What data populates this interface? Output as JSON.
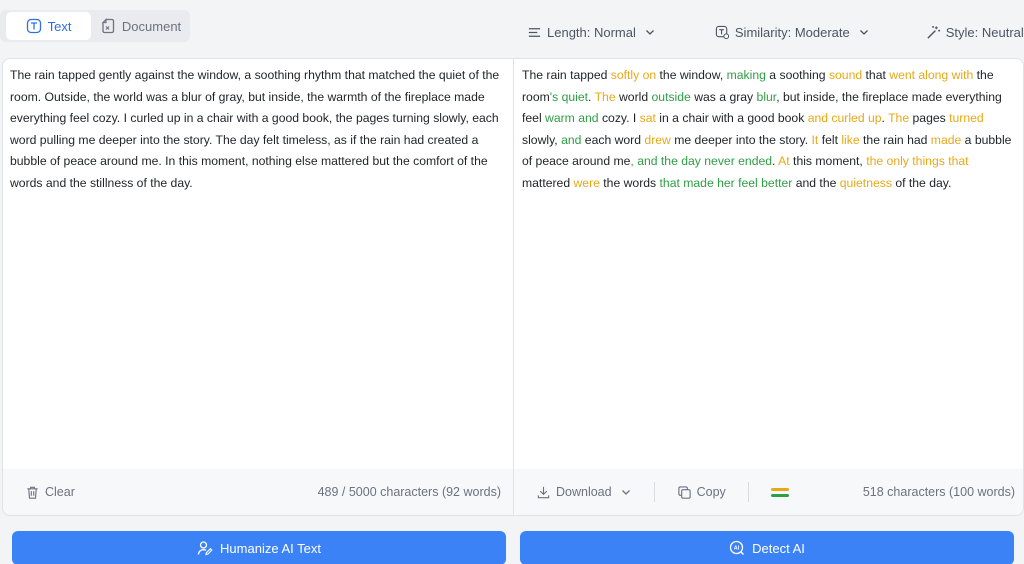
{
  "tabs": [
    {
      "label": "Text",
      "icon": "text-icon",
      "active": true
    },
    {
      "label": "Document",
      "icon": "document-icon",
      "active": false
    }
  ],
  "options": {
    "length": "Length: Normal",
    "similarity": "Similarity: Moderate",
    "style": "Style: Neutral"
  },
  "input": {
    "text": "The rain tapped gently against the window, a soothing rhythm that matched the quiet of the room. Outside, the world was a blur of gray, but inside, the warmth of the fireplace made everything feel cozy. I curled up in a chair with a good book, the pages turning slowly, each word pulling me deeper into the story. The day felt timeless, as if the rain had created a bubble of peace around me. In this moment, nothing else mattered but the comfort of the words and the stillness of the day.",
    "clear_label": "Clear",
    "char_count": "489 / 5000 characters (92 words)"
  },
  "output": {
    "segments": [
      {
        "t": "The rain tapped ",
        "c": "n"
      },
      {
        "t": "softly on",
        "c": "o"
      },
      {
        "t": " the window, ",
        "c": "n"
      },
      {
        "t": "making",
        "c": "g"
      },
      {
        "t": " a soothing ",
        "c": "n"
      },
      {
        "t": "sound",
        "c": "o"
      },
      {
        "t": " that ",
        "c": "n"
      },
      {
        "t": "went along with",
        "c": "o"
      },
      {
        "t": " the room",
        "c": "n"
      },
      {
        "t": "'s quiet",
        "c": "g"
      },
      {
        "t": ". ",
        "c": "n"
      },
      {
        "t": "The",
        "c": "o"
      },
      {
        "t": " world ",
        "c": "n"
      },
      {
        "t": "outside",
        "c": "g"
      },
      {
        "t": " was a gray ",
        "c": "n"
      },
      {
        "t": "blur",
        "c": "g"
      },
      {
        "t": ", but inside, the fireplace made everything feel ",
        "c": "n"
      },
      {
        "t": "warm and",
        "c": "g"
      },
      {
        "t": " cozy. I ",
        "c": "n"
      },
      {
        "t": "sat",
        "c": "o"
      },
      {
        "t": " in a chair with a good book ",
        "c": "n"
      },
      {
        "t": "and curled up",
        "c": "o"
      },
      {
        "t": ". ",
        "c": "n"
      },
      {
        "t": "The",
        "c": "o"
      },
      {
        "t": " pages ",
        "c": "n"
      },
      {
        "t": "turned",
        "c": "o"
      },
      {
        "t": " slowly, ",
        "c": "n"
      },
      {
        "t": "and",
        "c": "g"
      },
      {
        "t": " each word ",
        "c": "n"
      },
      {
        "t": "drew",
        "c": "o"
      },
      {
        "t": " me deeper into the story. ",
        "c": "n"
      },
      {
        "t": "It",
        "c": "o"
      },
      {
        "t": " felt ",
        "c": "n"
      },
      {
        "t": "like",
        "c": "o"
      },
      {
        "t": " the rain had ",
        "c": "n"
      },
      {
        "t": "made",
        "c": "o"
      },
      {
        "t": " a bubble of peace around me",
        "c": "n"
      },
      {
        "t": ", and the day never ended",
        "c": "g"
      },
      {
        "t": ". ",
        "c": "n"
      },
      {
        "t": "At",
        "c": "o"
      },
      {
        "t": " this moment, ",
        "c": "n"
      },
      {
        "t": "the only things that",
        "c": "o"
      },
      {
        "t": " mattered ",
        "c": "n"
      },
      {
        "t": "were",
        "c": "o"
      },
      {
        "t": " the words ",
        "c": "n"
      },
      {
        "t": "that made her feel better",
        "c": "g"
      },
      {
        "t": " and the ",
        "c": "n"
      },
      {
        "t": "quietness",
        "c": "o"
      },
      {
        "t": " of the day.",
        "c": "n"
      }
    ],
    "download_label": "Download",
    "copy_label": "Copy",
    "char_count": "518 characters (100 words)"
  },
  "colors": {
    "accent": "#3b82f6",
    "highlight_orange": "#e8a816",
    "highlight_green": "#2f9e44"
  },
  "actions": {
    "humanize": "Humanize AI Text",
    "detect": "Detect AI"
  }
}
